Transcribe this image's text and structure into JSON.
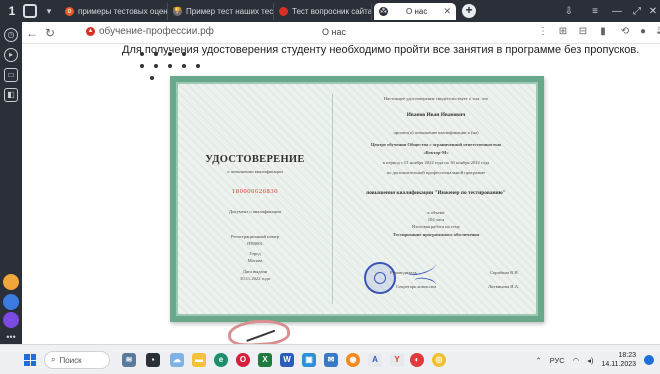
{
  "browser": {
    "tabs": [
      {
        "label": "примеры тестовых оценок"
      },
      {
        "label": "Пример тест наших тесто"
      },
      {
        "label": "Тест вопросник сайта с про"
      },
      {
        "label": "О нас"
      }
    ],
    "active_tab_index": 3,
    "new_tab_label": "+",
    "address": "обучение-профессии.рф",
    "page_title": "О нас"
  },
  "page": {
    "headline": "Для получения удостоверения студенту необходимо пройти все занятия в программе без пропусков."
  },
  "certificate": {
    "title": "УДОСТОВЕРЕНИЕ",
    "subtitle": "о повышении квалификации",
    "number": "180000626830",
    "validity": "Документ о квалификации",
    "reg_label": "Регистрационный номер",
    "reg_value": "ПП0001",
    "city_label": "Город",
    "city_value": "Москва",
    "date_label": "Дата выдачи",
    "date_value": "30.11.2022 года",
    "intro": "Настоящее удостоверение свидетельствует о том, что",
    "holder": "Иванов Иван Иванович",
    "passed": "прошел(а) повышение квалификации в (на)",
    "org_line1": "Центре обучения Общества с ограниченной ответственностью",
    "org_line2": "«Вектор-М»",
    "period": "в период с 01 ноября 2022 года по 30 ноября 2022 года",
    "program_label": "по дополнительной профессиональной программе",
    "program": "повышения квалификации \"Инженер по тестированию\"",
    "volume_label": "в объеме",
    "volume": "104 часа",
    "final_label": "Итоговая работа на тему",
    "final_topic": "Тестирование программного обеспечения",
    "director_label": "Руководитель",
    "director_name": "Скрябина В.Н.",
    "secretary_label": "Секретарь комиссии",
    "secretary_name": "Литвинова И.А."
  },
  "taskbar": {
    "search_label": "Поиск",
    "lang": "РУС",
    "time": "18:23",
    "date": "14.11.2023"
  }
}
